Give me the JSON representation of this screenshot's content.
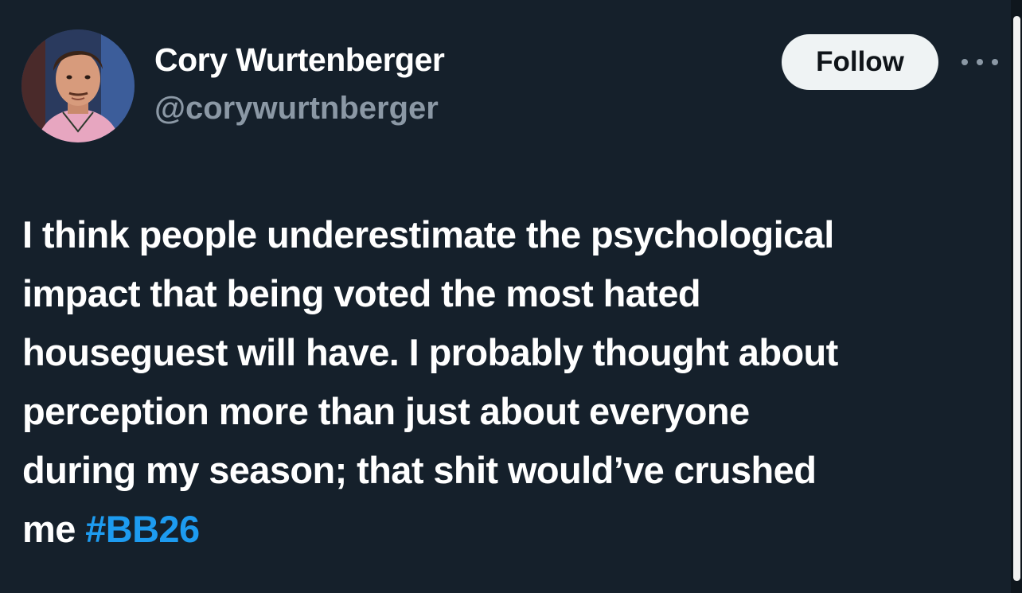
{
  "author": {
    "display_name": "Cory Wurtenberger",
    "handle": "@corywurtnberger",
    "avatar_icon": "profile-photo"
  },
  "actions": {
    "follow_label": "Follow",
    "more_icon": "more-horizontal-icon"
  },
  "tweet": {
    "lines": [
      "I think people underestimate the psychological",
      "impact that being voted the most hated",
      "houseguest will have. I probably thought about",
      "perception more than just about everyone",
      "during my season; that shit would’ve crushed",
      "me"
    ],
    "hashtag": "#BB26"
  },
  "colors": {
    "background": "#15202b",
    "text": "#ffffff",
    "secondary": "#8b98a5",
    "accent": "#1d9bf0",
    "button_bg": "#eff3f4"
  }
}
